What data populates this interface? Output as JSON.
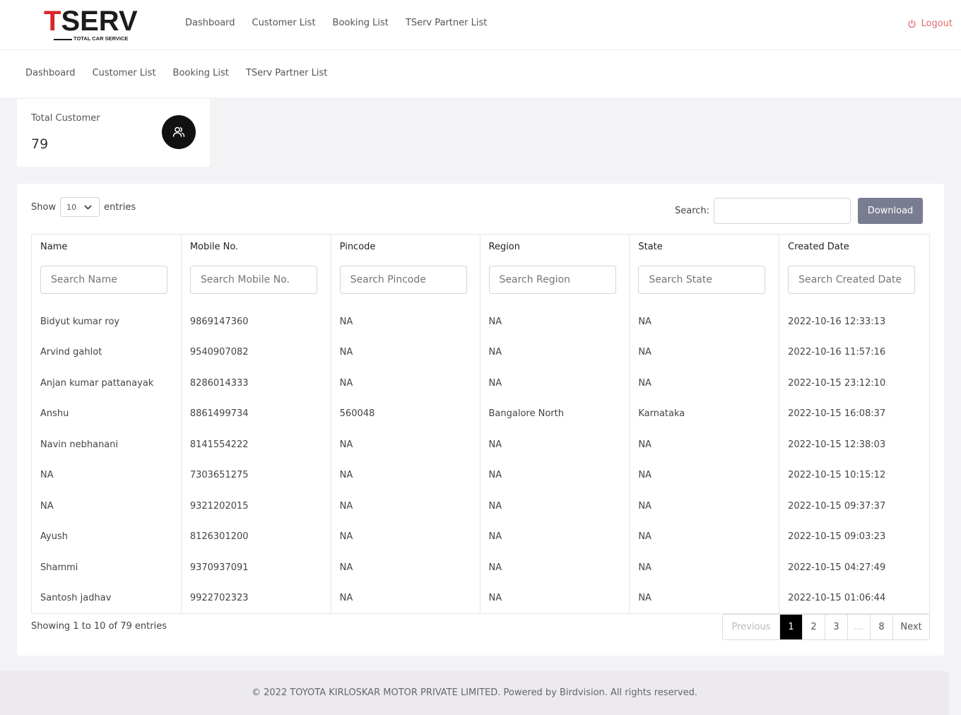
{
  "logo": {
    "main_t": "T",
    "main_rest": "SERV",
    "sub": "TOTAL CAR SERVICE"
  },
  "topnav": [
    "Dashboard",
    "Customer List",
    "Booking List",
    "TServ Partner List"
  ],
  "logout_label": "Logout",
  "subnav": [
    "Dashboard",
    "Customer List",
    "Booking List",
    "TServ Partner List"
  ],
  "stat": {
    "label": "Total Customer",
    "value": "79",
    "icon": "users-icon"
  },
  "controls": {
    "show_label": "Show",
    "entries_value": "10",
    "entries_label": "entries",
    "search_label": "Search:",
    "download_label": "Download"
  },
  "table": {
    "headers": [
      "Name",
      "Mobile No.",
      "Pincode",
      "Region",
      "State",
      "Created Date"
    ],
    "filters": [
      "Search Name",
      "Search Mobile No.",
      "Search Pincode",
      "Search Region",
      "Search State",
      "Search Created Date"
    ],
    "rows": [
      [
        "Bidyut kumar roy",
        "9869147360",
        "NA",
        "NA",
        "NA",
        "2022-10-16 12:33:13"
      ],
      [
        "Arvind gahlot",
        "9540907082",
        "NA",
        "NA",
        "NA",
        "2022-10-16 11:57:16"
      ],
      [
        "Anjan kumar pattanayak",
        "8286014333",
        "NA",
        "NA",
        "NA",
        "2022-10-15 23:12:10"
      ],
      [
        "Anshu",
        "8861499734",
        "560048",
        "Bangalore North",
        "Karnataka",
        "2022-10-15 16:08:37"
      ],
      [
        "Navin nebhanani",
        "8141554222",
        "NA",
        "NA",
        "NA",
        "2022-10-15 12:38:03"
      ],
      [
        "NA",
        "7303651275",
        "NA",
        "NA",
        "NA",
        "2022-10-15 10:15:12"
      ],
      [
        "NA",
        "9321202015",
        "NA",
        "NA",
        "NA",
        "2022-10-15 09:37:37"
      ],
      [
        "Ayush",
        "8126301200",
        "NA",
        "NA",
        "NA",
        "2022-10-15 09:03:23"
      ],
      [
        "Shammi",
        "9370937091",
        "NA",
        "NA",
        "NA",
        "2022-10-15 04:27:49"
      ],
      [
        "Santosh jadhav",
        "9922702323",
        "NA",
        "NA",
        "NA",
        "2022-10-15 01:06:44"
      ]
    ]
  },
  "info": "Showing 1 to 10 of 79 entries",
  "pagination": {
    "previous": "Previous",
    "pages": [
      "1",
      "2",
      "3",
      "…",
      "8"
    ],
    "next": "Next",
    "active": "1"
  },
  "footer": "© 2022 TOYOTA KIRLOSKAR MOTOR PRIVATE LIMITED. Powered by Birdvision. All rights reserved."
}
